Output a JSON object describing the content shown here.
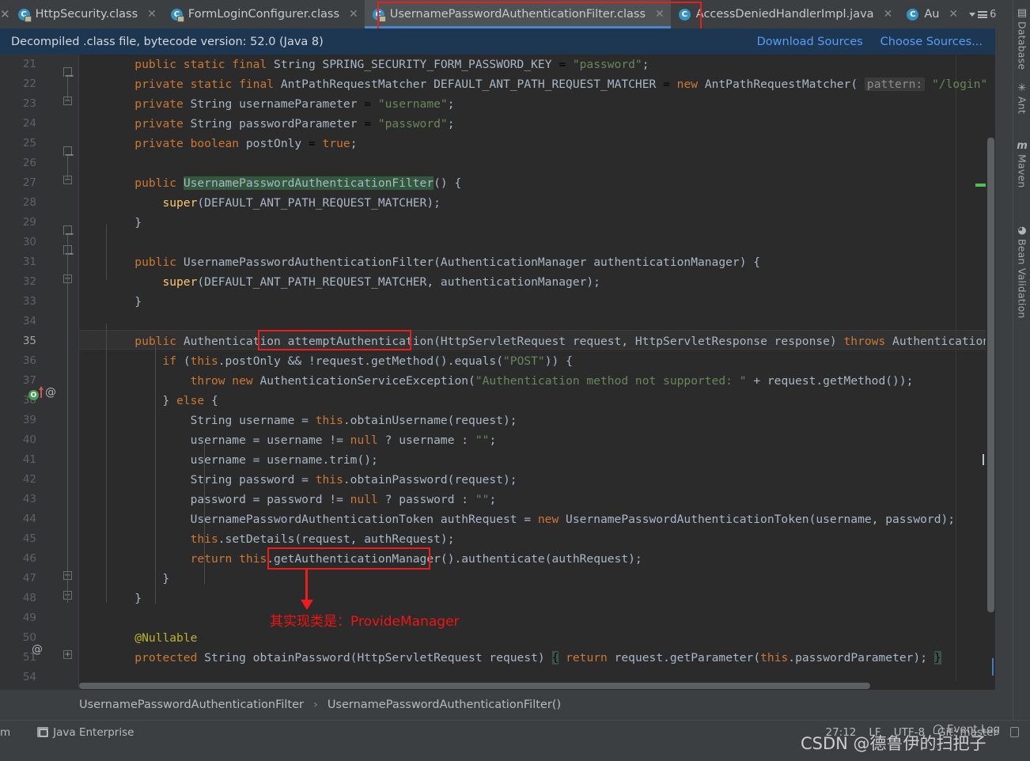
{
  "tabs": [
    {
      "label": "HttpSecurity.class",
      "icon": "java-class-locked-icon",
      "active": false
    },
    {
      "label": "FormLoginConfigurer.class",
      "icon": "java-class-locked-icon",
      "active": false
    },
    {
      "label": "UsernamePasswordAuthenticationFilter.class",
      "icon": "java-class-locked-icon",
      "active": true
    },
    {
      "label": "AccessDeniedHandlerImpl.java",
      "icon": "java-class-icon",
      "active": false
    },
    {
      "label": "Au",
      "icon": "java-class-icon",
      "active": false
    }
  ],
  "tab_overflow_count": "6",
  "notice": {
    "message": "Decompiled .class file, bytecode version: 52.0 (Java 8)",
    "download_sources": "Download Sources",
    "choose_sources": "Choose Sources..."
  },
  "editor": {
    "caret_line_number": 35,
    "lines": [
      {
        "num": "21",
        "indent": 4
      },
      {
        "num": "22",
        "indent": 4
      },
      {
        "num": "23",
        "indent": 4
      },
      {
        "num": "24",
        "indent": 4
      },
      {
        "num": "25",
        "indent": 4
      },
      {
        "num": "26",
        "indent": 0
      },
      {
        "num": "27",
        "indent": 4
      },
      {
        "num": "28",
        "indent": 8
      },
      {
        "num": "29",
        "indent": 4
      },
      {
        "num": "30",
        "indent": 0
      },
      {
        "num": "31",
        "indent": 4
      },
      {
        "num": "32",
        "indent": 8
      },
      {
        "num": "33",
        "indent": 4
      },
      {
        "num": "34",
        "indent": 0
      },
      {
        "num": "35",
        "indent": 4
      },
      {
        "num": "36",
        "indent": 8
      },
      {
        "num": "37",
        "indent": 12
      },
      {
        "num": "38",
        "indent": 8
      },
      {
        "num": "39",
        "indent": 12
      },
      {
        "num": "40",
        "indent": 12
      },
      {
        "num": "41",
        "indent": 12
      },
      {
        "num": "42",
        "indent": 12
      },
      {
        "num": "43",
        "indent": 12
      },
      {
        "num": "44",
        "indent": 12
      },
      {
        "num": "45",
        "indent": 12
      },
      {
        "num": "46",
        "indent": 12
      },
      {
        "num": "47",
        "indent": 8
      },
      {
        "num": "48",
        "indent": 4
      },
      {
        "num": "49",
        "indent": 0
      },
      {
        "num": "50",
        "indent": 4
      },
      {
        "num": "51",
        "indent": 4
      },
      {
        "num": "54",
        "indent": 0
      }
    ],
    "code_text": {
      "l21": "public static final String SPRING_SECURITY_FORM_PASSWORD_KEY = \"password\";",
      "l22": "private static final AntPathRequestMatcher DEFAULT_ANT_PATH_REQUEST_MATCHER = new AntPathRequestMatcher( pattern: \"/login\", httpM",
      "l23": "private String usernameParameter = \"username\";",
      "l24": "private String passwordParameter = \"password\";",
      "l25": "private boolean postOnly = true;",
      "l27": "public UsernamePasswordAuthenticationFilter() {",
      "l28": "super(DEFAULT_ANT_PATH_REQUEST_MATCHER);",
      "l29": "}",
      "l31": "public UsernamePasswordAuthenticationFilter(AuthenticationManager authenticationManager) {",
      "l32": "super(DEFAULT_ANT_PATH_REQUEST_MATCHER, authenticationManager);",
      "l33": "}",
      "l35": "public Authentication attemptAuthentication(HttpServletRequest request, HttpServletResponse response) throws AuthenticationExce",
      "l36": "if (this.postOnly && !request.getMethod().equals(\"POST\")) {",
      "l37": "throw new AuthenticationServiceException(\"Authentication method not supported: \" + request.getMethod());",
      "l38": "} else {",
      "l39": "String username = this.obtainUsername(request);",
      "l40": "username = username != null ? username : \"\";",
      "l41": "username = username.trim();",
      "l42": "String password = this.obtainPassword(request);",
      "l43": "password = password != null ? password : \"\";",
      "l44": "UsernamePasswordAuthenticationToken authRequest = new UsernamePasswordAuthenticationToken(username, password);",
      "l45": "this.setDetails(request, authRequest);",
      "l46": "return this.getAuthenticationManager().authenticate(authRequest);",
      "l47": "}",
      "l48": "}",
      "l50": "@Nullable",
      "l51": "protected String obtainPassword(HttpServletRequest request) { return request.getParameter(this.passwordParameter); }"
    }
  },
  "annotations": {
    "note_text": "其实现类是：ProvideManager",
    "color": "#ee1c1c",
    "boxes": [
      "tab-UsernamePasswordAuthenticationFilter.class",
      "attemptAuthentication",
      "getAuthenticationManager()"
    ]
  },
  "breadcrumb": {
    "class": "UsernamePasswordAuthenticationFilter",
    "separator": "›",
    "member": "UsernamePasswordAuthenticationFilter()"
  },
  "statusbar": {
    "fragment_left": "m",
    "java_enterprise": "Java Enterprise",
    "caret_position": "27:12",
    "line_separator": "LF",
    "encoding": "UTF-8",
    "branch": "Git: master",
    "event_log": "Event Log"
  },
  "right_tool_window": [
    {
      "label": "Database",
      "glyph": "▤",
      "icon": "database-icon"
    },
    {
      "label": "Ant",
      "glyph": "✳",
      "icon": "ant-icon"
    },
    {
      "label": "Maven",
      "glyph": "m",
      "icon": "maven-icon"
    },
    {
      "label": "Bean Validation",
      "glyph": "◕",
      "icon": "bean-validation-icon"
    }
  ],
  "watermark": {
    "text": "CSDN @德鲁伊的扫把子"
  }
}
